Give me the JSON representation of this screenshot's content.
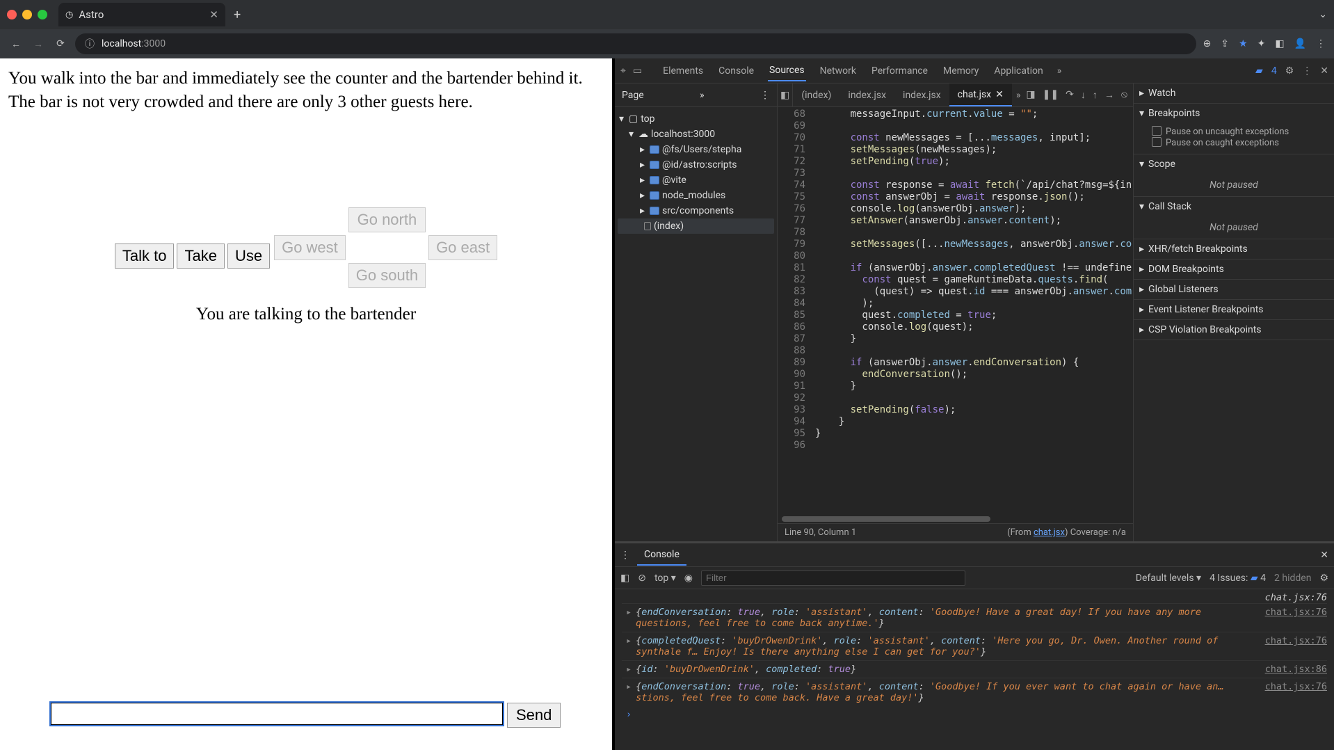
{
  "browser": {
    "tab_title": "Astro",
    "url": "localhost:3000",
    "url_host": "localhost",
    "url_port": ":3000"
  },
  "app": {
    "description": "You walk into the bar and immediately see the counter and the bartender behind it. The bar is not very crowded and there are only 3 other guests here.",
    "actions": {
      "talk": "Talk to",
      "take": "Take",
      "use": "Use"
    },
    "dirs": {
      "north": "Go north",
      "west": "Go west",
      "east": "Go east",
      "south": "Go south"
    },
    "status": "You are talking to the bartender",
    "send": "Send"
  },
  "devtools": {
    "tabs": [
      "Elements",
      "Console",
      "Sources",
      "Network",
      "Performance",
      "Memory",
      "Application"
    ],
    "active_tab": "Sources",
    "issue_count": "4",
    "page_tab": "Page",
    "tree": {
      "top": "top",
      "host": "localhost:3000",
      "items": [
        "@fs/Users/stepha",
        "@id/astro:scripts",
        "@vite",
        "node_modules",
        "src/components"
      ],
      "selected": "(index)"
    },
    "file_tabs": [
      "(index)",
      "index.jsx",
      "index.jsx",
      "chat.jsx"
    ],
    "active_file": "chat.jsx",
    "gutter_start": 68,
    "code_lines": [
      "      messageInput.current.value = \"\";",
      "",
      "      const newMessages = [...messages, input];",
      "      setMessages(newMessages);",
      "      setPending(true);",
      "",
      "      const response = await fetch(`/api/chat?msg=${in",
      "      const answerObj = await response.json();",
      "      console.log(answerObj.answer);",
      "      setAnswer(answerObj.answer.content);",
      "",
      "      setMessages([...newMessages, answerObj.answer.co",
      "",
      "      if (answerObj.answer.completedQuest !== undefine",
      "        const quest = gameRuntimeData.quests.find(",
      "          (quest) => quest.id === answerObj.answer.com",
      "        );",
      "        quest.completed = true;",
      "        console.log(quest);",
      "      }",
      "",
      "      if (answerObj.answer.endConversation) {",
      "        endConversation();",
      "      }",
      "",
      "      setPending(false);",
      "    }",
      "}",
      ""
    ],
    "cursor": "Line 90, Column 1",
    "from_label": "(From ",
    "from_file": "chat.jsx",
    "coverage": ") Coverage: n/a",
    "right": {
      "watch": "Watch",
      "breakpoints": "Breakpoints",
      "bp1": "Pause on uncaught exceptions",
      "bp2": "Pause on caught exceptions",
      "scope": "Scope",
      "not_paused": "Not paused",
      "callstack": "Call Stack",
      "xhr": "XHR/fetch Breakpoints",
      "dom": "DOM Breakpoints",
      "global": "Global Listeners",
      "event": "Event Listener Breakpoints",
      "csp": "CSP Violation Breakpoints"
    }
  },
  "console": {
    "title": "Console",
    "context": "top",
    "filter_ph": "Filter",
    "levels": "Default levels",
    "issues_lbl": "4 Issues:",
    "issues_n": "4",
    "hidden": "2 hidden",
    "logs": [
      {
        "src": "chat.jsx:76",
        "txt": "{endConversation: true, role: 'assistant', content: 'Goodbye! Have a great day! If you have any more questions, feel free to come back anytime.'}"
      },
      {
        "src": "chat.jsx:76",
        "txt": "{completedQuest: 'buyDrOwenDrink', role: 'assistant', content: 'Here you go, Dr. Owen. Another round of synthale f… Enjoy! Is there anything else I can get for you?'}"
      },
      {
        "src": "chat.jsx:86",
        "txt": "{id: 'buyDrOwenDrink', completed: true}"
      },
      {
        "src": "chat.jsx:76",
        "txt": "{endConversation: true, role: 'assistant', content: 'Goodbye! If you ever want to chat again or have an…stions, feel free to come back. Have a great day!'}"
      }
    ]
  }
}
